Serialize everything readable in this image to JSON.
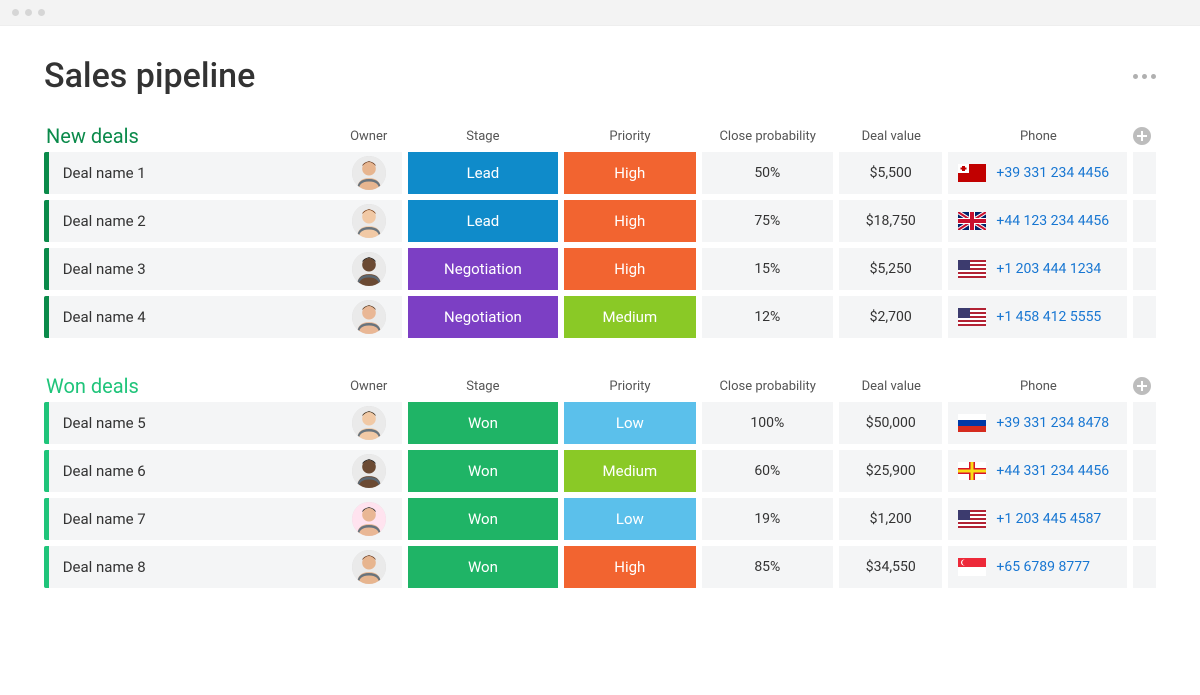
{
  "page": {
    "title": "Sales pipeline"
  },
  "columns": {
    "owner": "Owner",
    "stage": "Stage",
    "priority": "Priority",
    "probability": "Close probability",
    "value": "Deal value",
    "phone": "Phone"
  },
  "colors": {
    "stage": {
      "Lead": "#0f8bca",
      "Negotiation": "#7c3fc4",
      "Won": "#1fb466"
    },
    "priority": {
      "High": "#f26430",
      "Medium": "#8ac926",
      "Low": "#5bc0eb"
    },
    "group": {
      "new": "#0a8a4a",
      "won": "#1fc47a"
    }
  },
  "groups": [
    {
      "id": "new",
      "title": "New deals",
      "accent": "#0a8a4a",
      "title_color": "#0a8a4a",
      "deals": [
        {
          "name": "Deal name 1",
          "avatar": "f1",
          "stage": "Lead",
          "priority": "High",
          "probability": "50%",
          "value": "$5,500",
          "flag": "tonga",
          "phone": "+39 331 234 4456"
        },
        {
          "name": "Deal name 2",
          "avatar": "f2",
          "stage": "Lead",
          "priority": "High",
          "probability": "75%",
          "value": "$18,750",
          "flag": "uk",
          "phone": "+44 123 234 4456"
        },
        {
          "name": "Deal name 3",
          "avatar": "m1",
          "stage": "Negotiation",
          "priority": "High",
          "probability": "15%",
          "value": "$5,250",
          "flag": "us",
          "phone": "+1 203 444 1234"
        },
        {
          "name": "Deal name 4",
          "avatar": "m2",
          "stage": "Negotiation",
          "priority": "Medium",
          "probability": "12%",
          "value": "$2,700",
          "flag": "us",
          "phone": "+1 458 412 5555"
        }
      ]
    },
    {
      "id": "won",
      "title": "Won deals",
      "accent": "#1fc47a",
      "title_color": "#1fc47a",
      "deals": [
        {
          "name": "Deal name 5",
          "avatar": "m3",
          "stage": "Won",
          "priority": "Low",
          "probability": "100%",
          "value": "$50,000",
          "flag": "ru",
          "phone": "+39 331 234 8478"
        },
        {
          "name": "Deal name 6",
          "avatar": "m1",
          "stage": "Won",
          "priority": "Medium",
          "probability": "60%",
          "value": "$25,900",
          "flag": "guernsey",
          "phone": "+44 331 234 4456"
        },
        {
          "name": "Deal name 7",
          "avatar": "f3",
          "stage": "Won",
          "priority": "Low",
          "probability": "19%",
          "value": "$1,200",
          "flag": "us",
          "phone": "+1 203 445 4587"
        },
        {
          "name": "Deal name 8",
          "avatar": "f1",
          "stage": "Won",
          "priority": "High",
          "probability": "85%",
          "value": "$34,550",
          "flag": "sg",
          "phone": "+65 6789 8777"
        }
      ]
    }
  ]
}
